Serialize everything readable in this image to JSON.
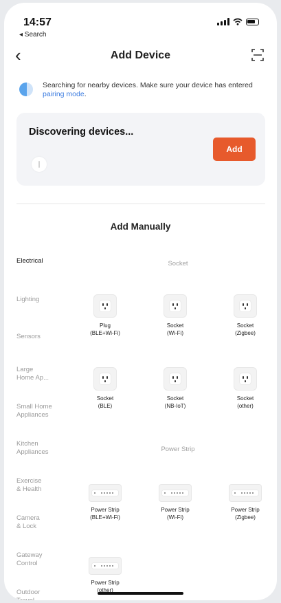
{
  "status": {
    "time": "14:57",
    "back_app": "◂ Search"
  },
  "nav": {
    "back_label": "‹",
    "title": "Add Device"
  },
  "bluetooth": {
    "text": "Searching for nearby devices. Make sure your device has entered ",
    "link": "pairing mode",
    "text_end": "."
  },
  "discover": {
    "title": "Discovering devices...",
    "add_label": "Add"
  },
  "manual": {
    "title": "Add Manually",
    "categories": [
      {
        "label": "Electrical",
        "active": true
      },
      {
        "label": "Lighting"
      },
      {
        "label": "Sensors"
      },
      {
        "label": "Large\nHome Ap..."
      },
      {
        "label": "Small Home\nAppliances"
      },
      {
        "label": "Kitchen\nAppliances"
      },
      {
        "label": "Exercise\n& Health"
      },
      {
        "label": "Camera\n& Lock"
      },
      {
        "label": "Gateway\nControl"
      },
      {
        "label": "Outdoor\nTravel"
      }
    ],
    "groups": [
      {
        "title": "Socket",
        "devices": [
          {
            "name": "Plug",
            "sub": "(BLE+Wi-Fi)"
          },
          {
            "name": "Socket",
            "sub": "(Wi-Fi)"
          },
          {
            "name": "Socket",
            "sub": "(Zigbee)"
          },
          {
            "name": "Socket",
            "sub": "(BLE)"
          },
          {
            "name": "Socket",
            "sub": "(NB-IoT)"
          },
          {
            "name": "Socket",
            "sub": "(other)"
          }
        ]
      },
      {
        "title": "Power Strip",
        "devices": [
          {
            "name": "Power Strip",
            "sub": "(BLE+Wi-Fi)"
          },
          {
            "name": "Power Strip",
            "sub": "(Wi-Fi)"
          },
          {
            "name": "Power Strip",
            "sub": "(Zigbee)"
          },
          {
            "name": "Power Strip",
            "sub": "(other)"
          }
        ]
      }
    ]
  },
  "colors": {
    "accent": "#e75a2c",
    "link": "#3a7be0",
    "card_bg": "#f3f4f7"
  }
}
